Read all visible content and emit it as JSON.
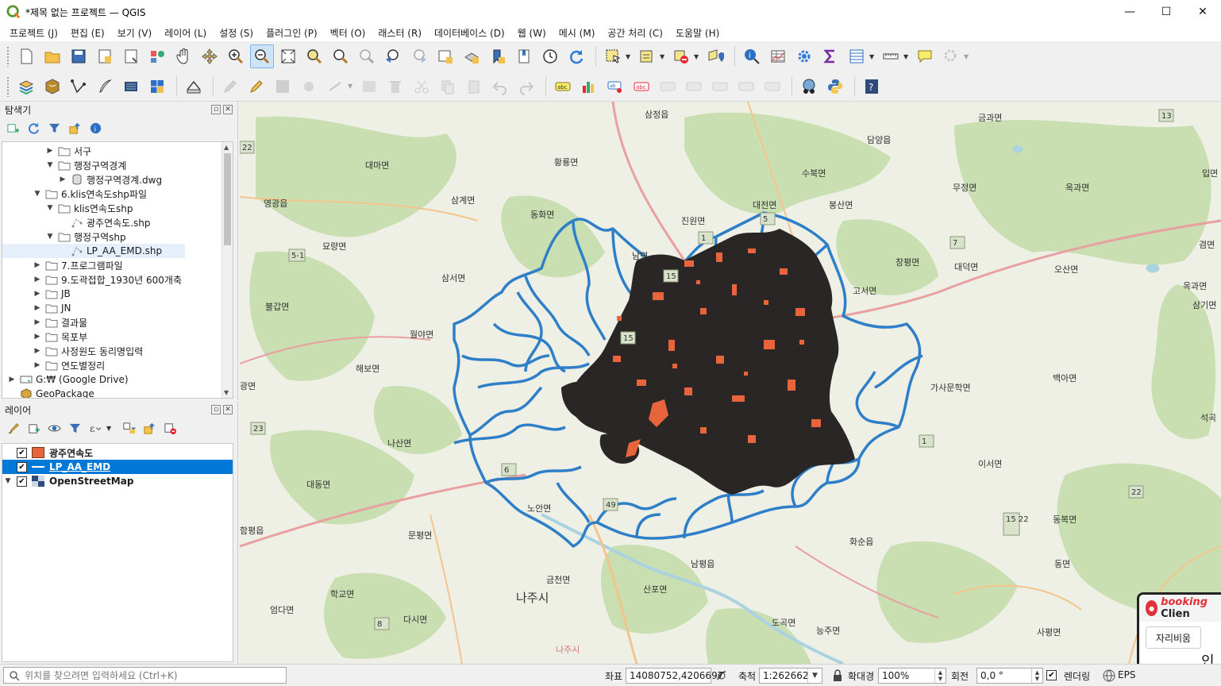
{
  "window": {
    "title": "*제목 없는 프로젝트 — QGIS",
    "minimize": "—",
    "maximize": "☐",
    "close": "✕"
  },
  "menu": [
    "프로젝트 (J)",
    "편집 (E)",
    "보기 (V)",
    "레이어 (L)",
    "설정 (S)",
    "플러그인 (P)",
    "벡터 (O)",
    "래스터 (R)",
    "데이터베이스 (D)",
    "웹 (W)",
    "메시 (M)",
    "공간 처리 (C)",
    "도움말 (H)"
  ],
  "browser": {
    "title": "탐색기",
    "items": [
      {
        "label": "서구",
        "level": 3,
        "expanded": false,
        "type": "folder"
      },
      {
        "label": "행정구역경계",
        "level": 3,
        "expanded": true,
        "type": "folder"
      },
      {
        "label": "행정구역경계.dwg",
        "level": 4,
        "expanded": false,
        "type": "db"
      },
      {
        "label": "6.klis연속도shp파일",
        "level": 2,
        "expanded": true,
        "type": "folder"
      },
      {
        "label": "klis연속도shp",
        "level": 3,
        "expanded": true,
        "type": "folder"
      },
      {
        "label": "광주연속도.shp",
        "level": 4,
        "expanded": null,
        "type": "shp"
      },
      {
        "label": "행정구역shp",
        "level": 3,
        "expanded": true,
        "type": "folder"
      },
      {
        "label": "LP_AA_EMD.shp",
        "level": 4,
        "expanded": null,
        "type": "shp",
        "selected": true
      },
      {
        "label": "7.프로그램파일",
        "level": 2,
        "expanded": false,
        "type": "folder"
      },
      {
        "label": "9.도곽접합_1930년 600개축",
        "level": 2,
        "expanded": false,
        "type": "folder"
      },
      {
        "label": "JB",
        "level": 2,
        "expanded": false,
        "type": "folder"
      },
      {
        "label": "JN",
        "level": 2,
        "expanded": false,
        "type": "folder"
      },
      {
        "label": "결과물",
        "level": 2,
        "expanded": false,
        "type": "folder"
      },
      {
        "label": "목포부",
        "level": 2,
        "expanded": false,
        "type": "folder"
      },
      {
        "label": "사정원도 동리명입력",
        "level": 2,
        "expanded": false,
        "type": "folder"
      },
      {
        "label": "연도별정리",
        "level": 2,
        "expanded": false,
        "type": "folder"
      },
      {
        "label": "G:₩ (Google Drive)",
        "level": 0,
        "expanded": false,
        "type": "drive"
      },
      {
        "label": "GeoPackage",
        "level": 0,
        "expanded": null,
        "type": "gpkg"
      }
    ]
  },
  "layers": {
    "title": "레이어",
    "items": [
      {
        "label": "광주연속도",
        "checked": true,
        "swatch": "#e8643a",
        "type": "fill"
      },
      {
        "label": "LP_AA_EMD",
        "checked": true,
        "swatch": "#2f7fc8",
        "type": "line",
        "selected": true
      },
      {
        "label": "OpenStreetMap",
        "checked": true,
        "type": "raster"
      }
    ]
  },
  "map_labels": [
    {
      "text": "삼정읍"
    },
    {
      "text": "담양읍"
    },
    {
      "text": "금과면"
    },
    {
      "text": "대마면"
    },
    {
      "text": "황룡면"
    },
    {
      "text": "수북면"
    },
    {
      "text": "입면"
    },
    {
      "text": "영광읍"
    },
    {
      "text": "삼계면"
    },
    {
      "text": "대전면"
    },
    {
      "text": "봉산면"
    },
    {
      "text": "무정면"
    },
    {
      "text": "옥과면"
    },
    {
      "text": "동화면"
    },
    {
      "text": "진원면"
    },
    {
      "text": "묘량면"
    },
    {
      "text": "겸면"
    },
    {
      "text": "남면"
    },
    {
      "text": "창평면"
    },
    {
      "text": "대덕면"
    },
    {
      "text": "삼서면"
    },
    {
      "text": "오산면"
    },
    {
      "text": "고서면"
    },
    {
      "text": "불갑면"
    },
    {
      "text": "옥과면"
    },
    {
      "text": "삼기면"
    },
    {
      "text": "월야면"
    },
    {
      "text": "해보면"
    },
    {
      "text": "가사문학면"
    },
    {
      "text": "백아면"
    },
    {
      "text": "광면"
    },
    {
      "text": "석곡"
    },
    {
      "text": "나산면"
    },
    {
      "text": "이서면"
    },
    {
      "text": "대동면"
    },
    {
      "text": "노안면"
    },
    {
      "text": "함평읍"
    },
    {
      "text": "동복면"
    },
    {
      "text": "문평면"
    },
    {
      "text": "화순읍"
    },
    {
      "text": "남평읍"
    },
    {
      "text": "동면"
    },
    {
      "text": "금천면"
    },
    {
      "text": "산포면"
    },
    {
      "text": "학교면"
    },
    {
      "text": "엄다면"
    },
    {
      "text": "나주시"
    },
    {
      "text": "다시면"
    },
    {
      "text": "도곡면"
    },
    {
      "text": "능주면"
    },
    {
      "text": "사평면"
    },
    {
      "text": "나주시"
    }
  ],
  "road_shields": [
    "13",
    "22",
    "23",
    "49",
    "22",
    "15 22",
    "5",
    "1",
    "15",
    "7",
    "6",
    "5-1",
    "1",
    "8",
    "15"
  ],
  "popup": {
    "brand_prefix": "booking",
    "brand_suffix": "Clien",
    "button": "자리비움",
    "text": "인터"
  },
  "statusbar": {
    "locator_placeholder": "위치를 찾으려면 입력하세요 (Ctrl+K)",
    "coord_label": "좌표",
    "coord_value": "14080752,4206697",
    "scale_label": "축척",
    "scale_value": "1:262662",
    "magnifier_label": "확대경",
    "magnifier_value": "100%",
    "rotation_label": "회전",
    "rotation_value": "0,0 °",
    "render_label": "렌더링",
    "epsg": "EPS"
  },
  "colors": {
    "polygon_outline": "#2f7fc8",
    "parcel_fill": "#2a2626",
    "parcel_accent": "#e8643a",
    "map_green": "#c8dfb0",
    "map_bg": "#eef0e6",
    "selection": "#0078d7"
  }
}
